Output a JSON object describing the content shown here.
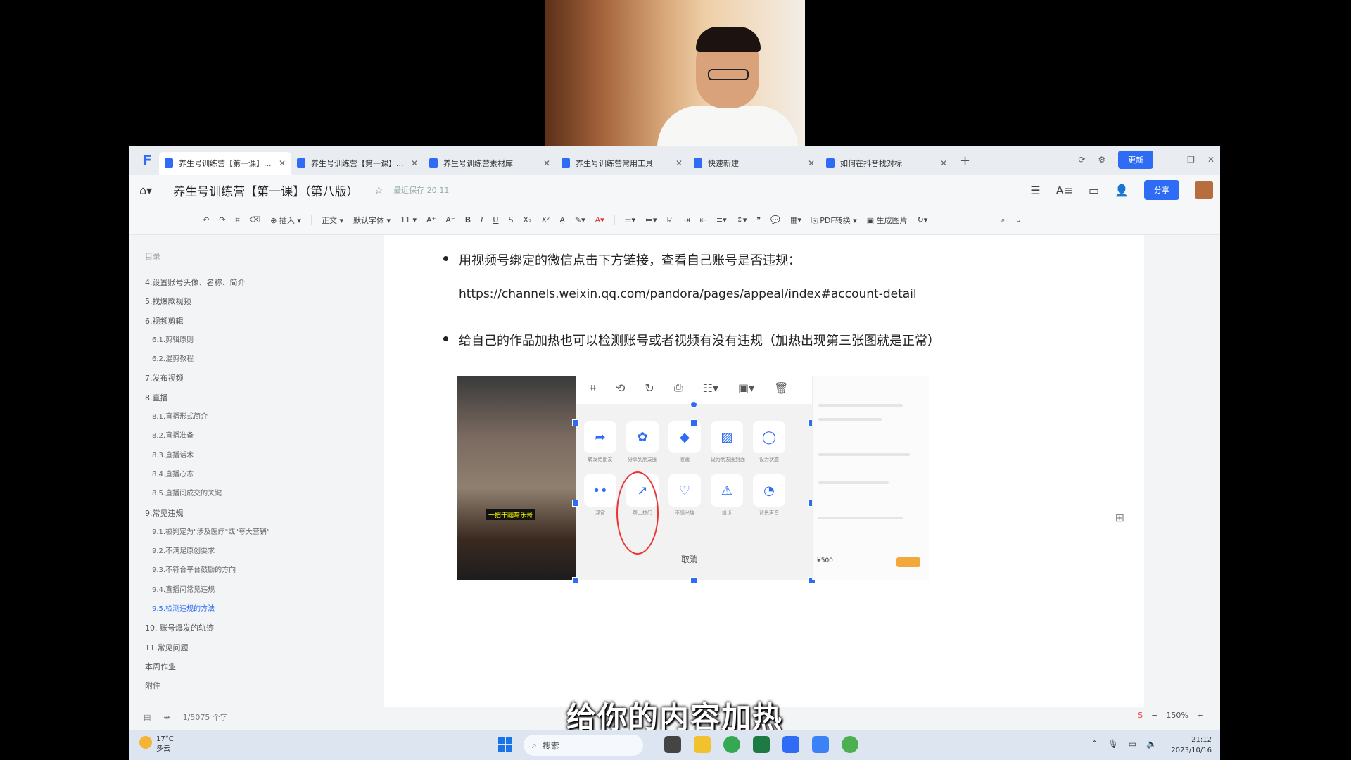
{
  "tabs": [
    {
      "label": "养生号训练营【第一课】...",
      "active": true
    },
    {
      "label": "养生号训练营【第一课】...",
      "active": false
    },
    {
      "label": "养生号训练营素材库",
      "active": false
    },
    {
      "label": "养生号训练营常用工具",
      "active": false
    },
    {
      "label": "快速新建",
      "active": false
    },
    {
      "label": "如何在抖音找对标",
      "active": false
    }
  ],
  "window": {
    "update_label": "更新"
  },
  "title": {
    "doc_title": "养生号训练营【第一课】（第八版）",
    "save_status": "最近保存 20:11",
    "share_label": "分享"
  },
  "toolbar": {
    "insert": "插入",
    "style": "正文",
    "font": "默认字体",
    "size": "11",
    "pdf": "PDF转换",
    "gen_image": "生成图片"
  },
  "sidebar": {
    "toc_title": "目录",
    "items": [
      {
        "label": "4.设置账号头像、名称、简介",
        "sub": false,
        "active": false
      },
      {
        "label": "5.找爆款视频",
        "sub": false,
        "active": false
      },
      {
        "label": "6.视频剪辑",
        "sub": false,
        "active": false
      },
      {
        "label": "6.1.剪辑原则",
        "sub": true,
        "active": false
      },
      {
        "label": "6.2.混剪教程",
        "sub": true,
        "active": false
      },
      {
        "label": "7.发布视频",
        "sub": false,
        "active": false
      },
      {
        "label": "8.直播",
        "sub": false,
        "active": false
      },
      {
        "label": "8.1.直播形式简介",
        "sub": true,
        "active": false
      },
      {
        "label": "8.2.直播准备",
        "sub": true,
        "active": false
      },
      {
        "label": "8.3.直播话术",
        "sub": true,
        "active": false
      },
      {
        "label": "8.4.直播心态",
        "sub": true,
        "active": false
      },
      {
        "label": "8.5.直播间成交的关键",
        "sub": true,
        "active": false
      },
      {
        "label": "9.常见违规",
        "sub": false,
        "active": false
      },
      {
        "label": "9.1.被判定为\"涉及医疗\"或\"夸大营销\"",
        "sub": true,
        "active": false
      },
      {
        "label": "9.2.不满足原创要求",
        "sub": true,
        "active": false
      },
      {
        "label": "9.3.不符合平台鼓励的方向",
        "sub": true,
        "active": false
      },
      {
        "label": "9.4.直播间常见违规",
        "sub": true,
        "active": false
      },
      {
        "label": "9.5.检测违规的方法",
        "sub": true,
        "active": true
      },
      {
        "label": "10. 账号爆发的轨迹",
        "sub": false,
        "active": false
      },
      {
        "label": "11.常见问题",
        "sub": false,
        "active": false
      },
      {
        "label": "本周作业",
        "sub": false,
        "active": false
      },
      {
        "label": "附件",
        "sub": false,
        "active": false
      }
    ]
  },
  "content": {
    "bullet1": "用视频号绑定的微信点击下方链接，查看自己账号是否违规：",
    "url": "https://channels.weixin.qq.com/pandora/pages/appeal/index#account-detail",
    "bullet2": "给自己的作品加热也可以检测账号或者视频有没有违规（加热出现第三张图就是正常）",
    "image_caption": "一把干蹦啼乐哥",
    "share_row1": [
      "转发给朋友",
      "分享到朋友圈",
      "收藏",
      "设为朋友圈封面",
      "设为状态"
    ],
    "share_row2": [
      "浮窗",
      "帮上热门",
      "不感兴趣",
      "投诉",
      "背景声音"
    ],
    "cancel": "取消",
    "price": "¥500"
  },
  "subtitle": "给你的内容加热",
  "statusbar": {
    "word_count": "1/5075 个字",
    "zoom": "150%"
  },
  "taskbar": {
    "temp": "17°C",
    "weather": "多云",
    "search": "搜索",
    "time": "21:12",
    "date": "2023/10/16"
  }
}
